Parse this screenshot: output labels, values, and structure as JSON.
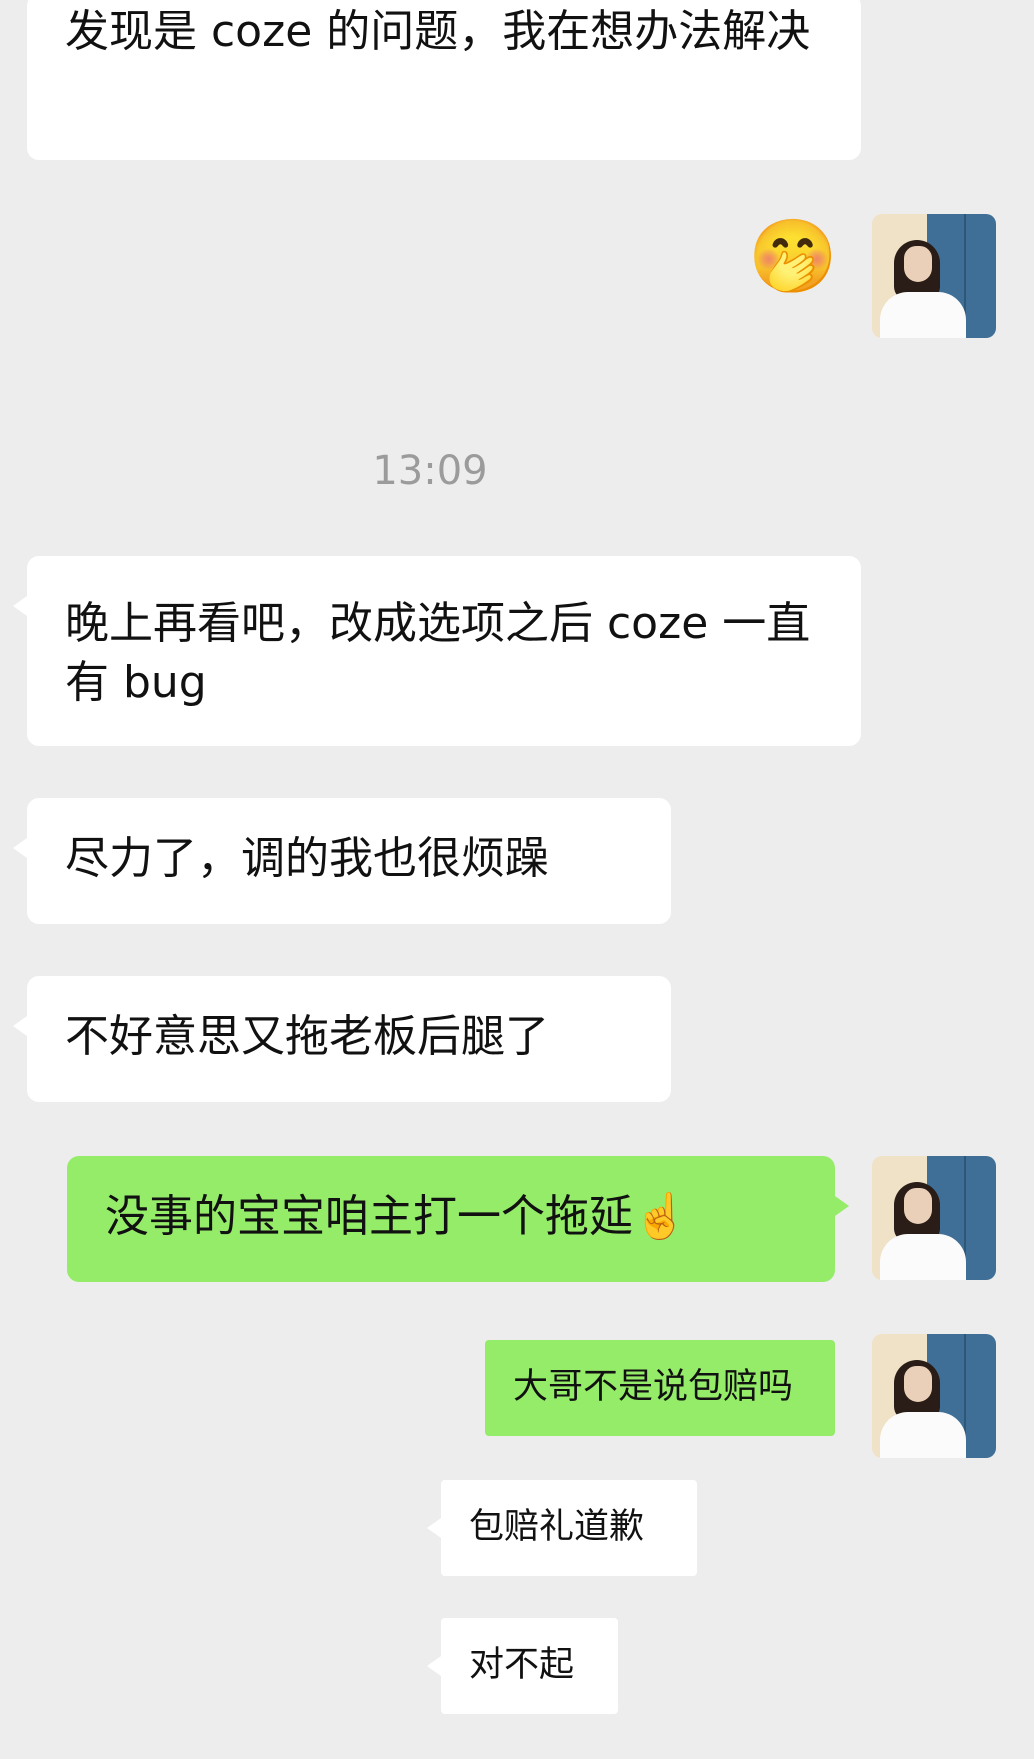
{
  "messages": [
    {
      "text": "发现是 coze 的问题，我在想办法解决"
    },
    {
      "text": "🤭"
    },
    {
      "text": "晚上再看吧，改成选项之后 coze 一直有 bug"
    },
    {
      "text": "尽力了，调的我也很烦躁"
    },
    {
      "text": "不好意思又拖老板后腿了"
    },
    {
      "text": "没事的宝宝咱主打一个拖延☝️"
    },
    {
      "text": "大哥不是说包赔吗"
    },
    {
      "text": "包赔礼道歉"
    },
    {
      "text": "对不起"
    }
  ],
  "timestamp": "13:09",
  "colors": {
    "background": "#ededed",
    "incoming_bubble": "#ffffff",
    "outgoing_bubble": "#95ec69",
    "timestamp_text": "#9b9b9b"
  }
}
